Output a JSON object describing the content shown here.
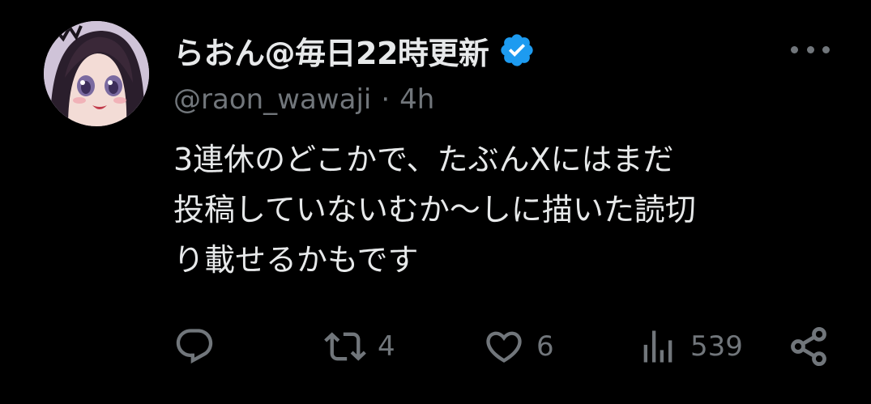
{
  "author": {
    "display_name": "らおん@毎日22時更新",
    "handle": "@raon_wawaji",
    "separator": "·",
    "time": "4h",
    "verified": true
  },
  "tweet": {
    "lines": [
      "3連休のどこかで、たぶんXにはまだ",
      "投稿していないむか～しに描いた読切",
      "り載せるかもです"
    ]
  },
  "actions": {
    "reply": {
      "icon": "reply-icon",
      "count": ""
    },
    "retweet": {
      "icon": "retweet-icon",
      "count": "4"
    },
    "like": {
      "icon": "heart-icon",
      "count": "6"
    },
    "views": {
      "icon": "views-icon",
      "count": "539"
    },
    "share": {
      "icon": "share-icon"
    }
  },
  "colors": {
    "background": "#000000",
    "primary_text": "#e7e9ea",
    "secondary_text": "#71767b",
    "verified_badge": "#1d9bf0"
  }
}
